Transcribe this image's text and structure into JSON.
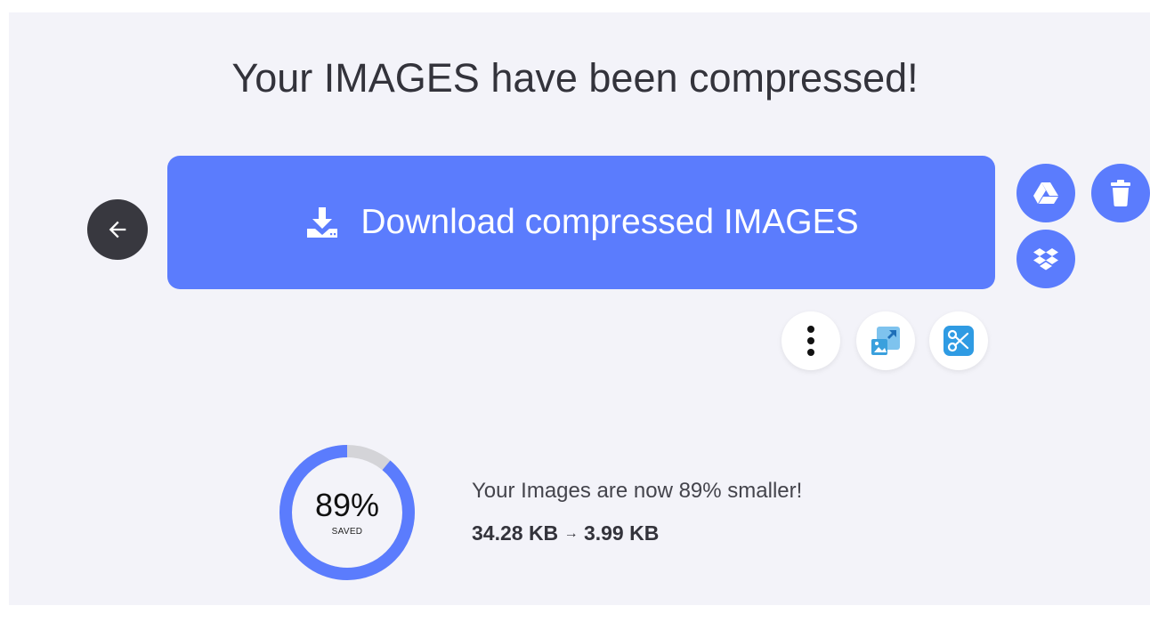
{
  "result": {
    "title": "Your IMAGES have been compressed!",
    "download_label": "Download compressed IMAGES",
    "percent_saved_label": "89%",
    "percent_saved_value": 0.89,
    "saved_caption": "SAVED",
    "summary_text": "Your Images are now 89% smaller!",
    "original_size": "34.28 KB",
    "arrow": "→",
    "compressed_size": "3.99 KB"
  },
  "actions": {
    "back": {
      "icon": "arrow-left-icon"
    },
    "google_drive": {
      "icon": "google-drive-icon"
    },
    "delete": {
      "icon": "trash-icon"
    },
    "dropbox": {
      "icon": "dropbox-icon"
    },
    "more": {
      "icon": "vertical-dots-icon"
    },
    "resize": {
      "icon": "resize-image-icon"
    },
    "crop": {
      "icon": "scissors-icon"
    }
  },
  "colors": {
    "accent": "#5b7cfd",
    "back_button": "#38383f",
    "background": "#f3f3f9",
    "ring_track": "#d4d4d8",
    "resize_icon": "#3aa0dd",
    "crop_icon": "#2f9be3"
  }
}
